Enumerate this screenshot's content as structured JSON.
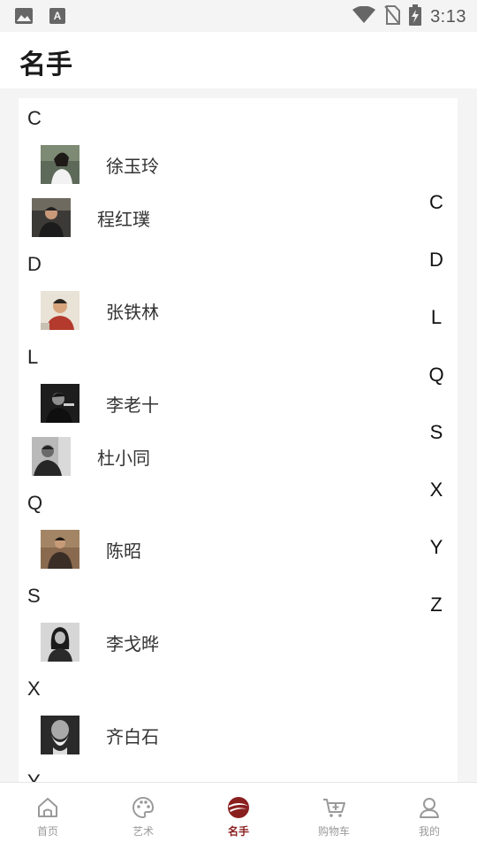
{
  "status_bar": {
    "time": "3:13",
    "icons": [
      "image-icon",
      "font-icon",
      "wifi-icon",
      "no-sim-icon",
      "battery-charging-icon"
    ]
  },
  "header": {
    "title": "名手"
  },
  "sections": [
    {
      "letter": "C",
      "artists": [
        {
          "name": "徐玉玲",
          "avatar": "photo"
        },
        {
          "name": "程红璞",
          "avatar": "photo"
        }
      ]
    },
    {
      "letter": "D",
      "artists": [
        {
          "name": "张铁林",
          "avatar": "photo"
        }
      ]
    },
    {
      "letter": "L",
      "artists": [
        {
          "name": "李老十",
          "avatar": "photo"
        },
        {
          "name": "杜小同",
          "avatar": "photo"
        }
      ]
    },
    {
      "letter": "Q",
      "artists": [
        {
          "name": "陈昭",
          "avatar": "photo"
        }
      ]
    },
    {
      "letter": "S",
      "artists": [
        {
          "name": "李戈晔",
          "avatar": "photo"
        }
      ]
    },
    {
      "letter": "X",
      "artists": [
        {
          "name": "齐白石",
          "avatar": "photo"
        }
      ]
    },
    {
      "letter": "Y",
      "artists": []
    }
  ],
  "index_letters": [
    "C",
    "D",
    "L",
    "Q",
    "S",
    "X",
    "Y",
    "Z"
  ],
  "bottom_nav": {
    "items": [
      {
        "label": "首页",
        "icon": "home-icon",
        "active": false
      },
      {
        "label": "艺术",
        "icon": "palette-icon",
        "active": false
      },
      {
        "label": "名手",
        "icon": "brand-logo-icon",
        "active": true
      },
      {
        "label": "购物车",
        "icon": "cart-icon",
        "active": false
      },
      {
        "label": "我的",
        "icon": "user-icon",
        "active": false
      }
    ]
  },
  "colors": {
    "accent": "#8a1f1f",
    "nav_inactive": "#9a9a9a",
    "background": "#f4f4f4"
  }
}
